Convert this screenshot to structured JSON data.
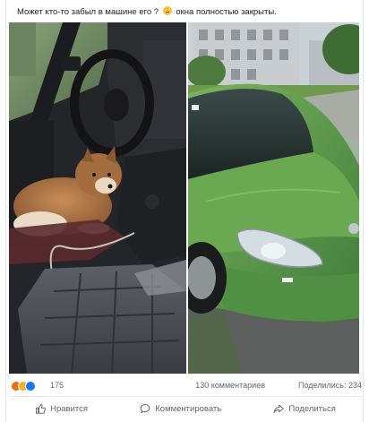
{
  "post": {
    "caption_part1": "Может кто-то забыл в машине его ?",
    "caption_emoji": "worried-face-icon",
    "caption_part2": "окна полностью закрыты.",
    "reactions": {
      "icons": [
        "angry-reaction-icon",
        "sad-reaction-icon",
        "like-reaction-icon"
      ],
      "count": "175"
    },
    "comments_count": "130 комментариев",
    "shares_count": "Поделились: 234",
    "actions": {
      "like": "Нравится",
      "comment": "Комментировать",
      "share": "Поделиться"
    }
  },
  "colors": {
    "car": "#5a9a4a",
    "dog": "#b07a4a",
    "link_gray": "#65676b",
    "like_blue": "#1877f2",
    "angry_orange": "#e9710f",
    "sad_yellow": "#f7b125"
  }
}
